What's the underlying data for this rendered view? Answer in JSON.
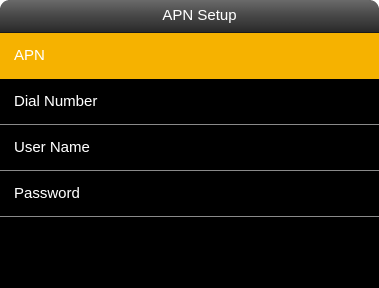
{
  "header": {
    "title": "APN Setup"
  },
  "menu": {
    "items": [
      {
        "label": "APN",
        "selected": true
      },
      {
        "label": "Dial Number",
        "selected": false
      },
      {
        "label": "User Name",
        "selected": false
      },
      {
        "label": "Password",
        "selected": false
      }
    ]
  },
  "colors": {
    "selected_bg": "#f6b200",
    "screen_bg": "#000000",
    "text": "#ffffff"
  }
}
